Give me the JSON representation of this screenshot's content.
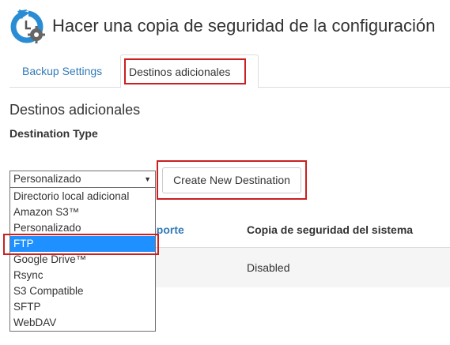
{
  "header": {
    "title": "Hacer una copia de seguridad de la configuración",
    "logo_icon": "backup-config-icon"
  },
  "tabs": [
    {
      "label": "Backup Settings",
      "active": false
    },
    {
      "label": "Destinos adicionales",
      "active": true
    }
  ],
  "section": {
    "title": "Destinos adicionales",
    "destination_type_label": "Destination Type"
  },
  "select": {
    "value": "Personalizado",
    "options": [
      "Directorio local adicional",
      "Amazon S3™",
      "Personalizado",
      "FTP",
      "Google Drive™",
      "Rsync",
      "S3 Compatible",
      "SFTP",
      "WebDAV"
    ],
    "highlighted": "FTP"
  },
  "create_button": {
    "label": "Create New Destination"
  },
  "table": {
    "headers": [
      "sporte",
      "Copia de seguridad del sistema"
    ],
    "rows": [
      {
        "system_backup": "Disabled"
      }
    ]
  },
  "colors": {
    "link": "#337ab7",
    "highlight_border": "#cc1f1f",
    "selected_option": "#1e90ff",
    "logo_blue": "#2a8dd4"
  }
}
